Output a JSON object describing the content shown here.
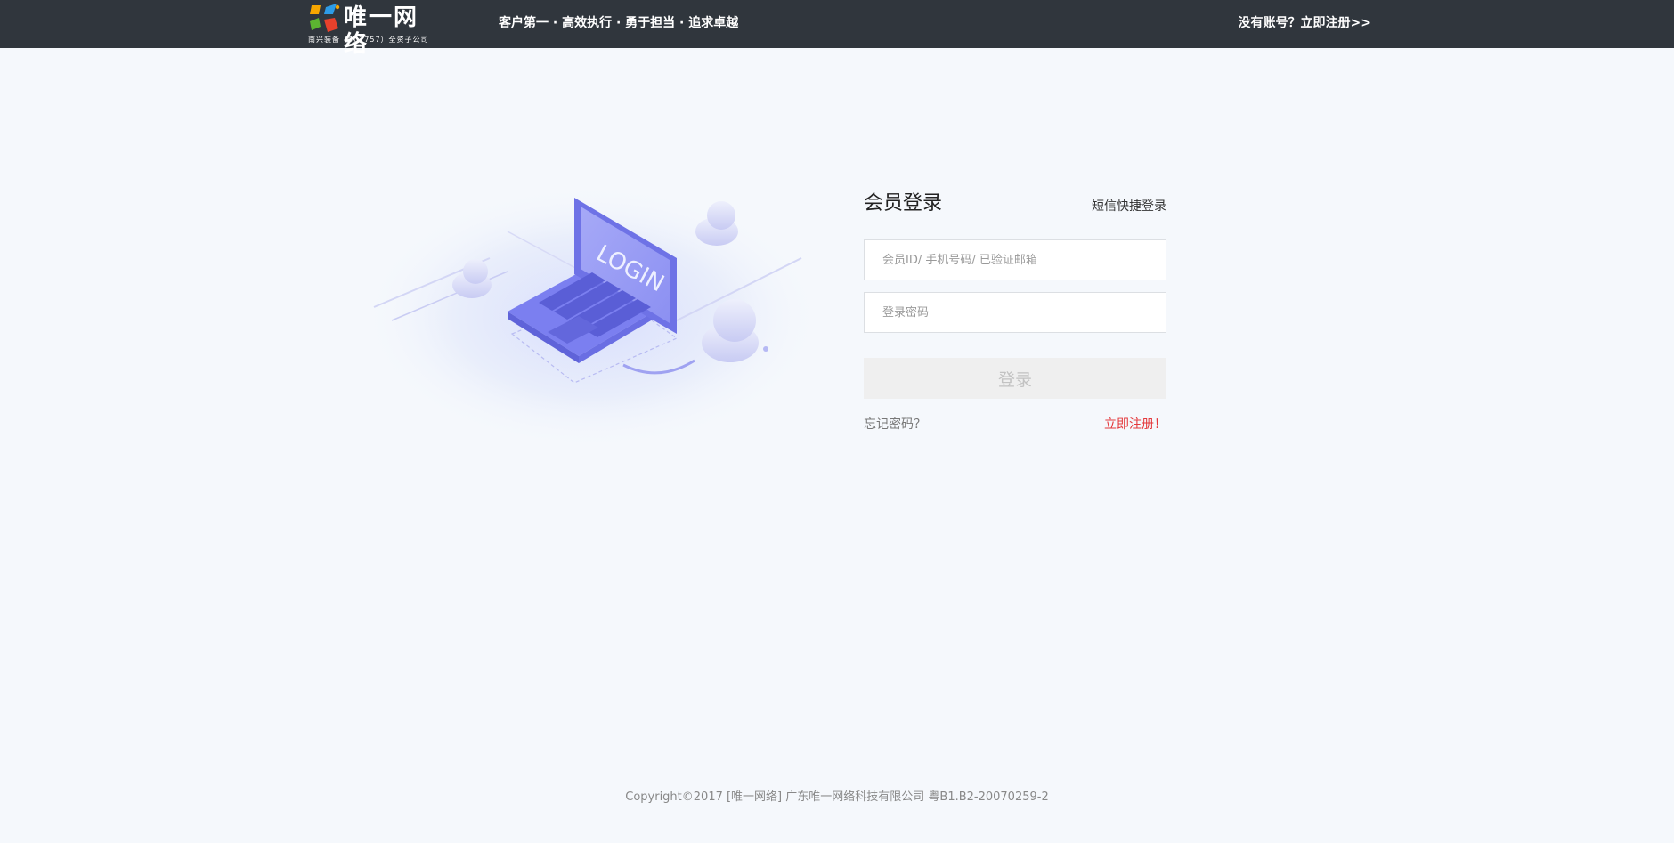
{
  "header": {
    "logo_text": "唯一网络",
    "logo_subtext": "南兴装备（002757）全资子公司",
    "slogan": "客户第一 · 高效执行 · 勇于担当 · 追求卓越",
    "register_link": "没有账号？立即注册>>"
  },
  "illustration": {
    "screen_text": "LOGIN"
  },
  "login": {
    "title": "会员登录",
    "sms_login": "短信快捷登录",
    "account_placeholder": "会员ID/ 手机号码/ 已验证邮箱",
    "password_placeholder": "登录密码",
    "submit_label": "登录",
    "forgot_password": "忘记密码？",
    "register_now": "立即注册！"
  },
  "footer": {
    "copyright": "Copyright©2017 [唯一网络] 广东唯一网络科技有限公司 粤B1.B2-20070259-2"
  },
  "colors": {
    "header_bg": "#30363d",
    "page_bg": "#f5f8fc",
    "accent_red": "#e4393c",
    "illustration_purple": "#7b7ff0"
  }
}
